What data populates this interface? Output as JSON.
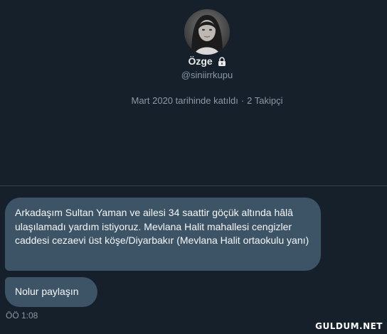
{
  "profile": {
    "name": "Özge",
    "handle": "@siniirrkupu",
    "joined": "Mart 2020 tarihinde katıldı",
    "separator": "·",
    "followers": "2 Takipçi"
  },
  "messages": [
    {
      "text": "Arkadaşım Sultan Yaman ve ailesi 34 saattir göçük altında hâlâ ulaşılamadı yardım istiyoruz. Mevlana Halit mahallesi cengizler caddesi cezaevi üst köşe/Diyarbakır  (Mevlana Halit ortaokulu yanı)"
    },
    {
      "text": "Nolur paylaşın"
    }
  ],
  "timestamp": "ÖÖ 1:08",
  "watermark": "GULDUM.NET",
  "colors": {
    "background": "#15202b",
    "bubble": "#3d5466",
    "muted_text": "#8b98a5"
  },
  "icons": {
    "lock": "lock-icon"
  }
}
